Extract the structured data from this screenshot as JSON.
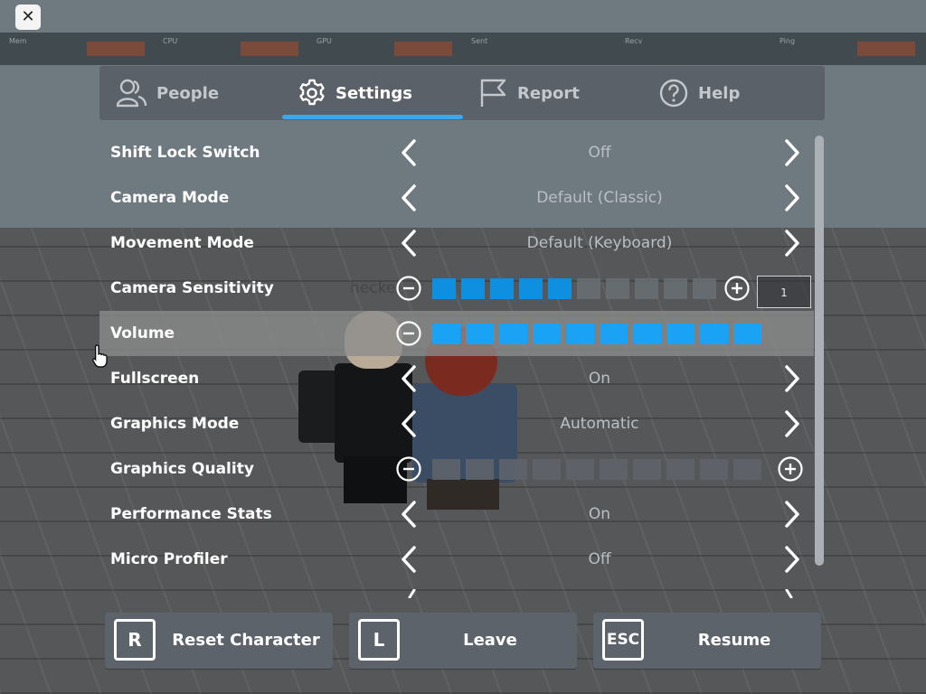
{
  "close_button": {
    "glyph": "✕"
  },
  "tabs": [
    {
      "label": "People",
      "icon": "people-icon",
      "active": false
    },
    {
      "label": "Settings",
      "icon": "gear-icon",
      "active": true
    },
    {
      "label": "Report",
      "icon": "flag-icon",
      "active": false
    },
    {
      "label": "Help",
      "icon": "help-icon",
      "active": false
    }
  ],
  "settings": {
    "shift_lock": {
      "label": "Shift Lock Switch",
      "value": "Off"
    },
    "camera_mode": {
      "label": "Camera Mode",
      "value": "Default (Classic)"
    },
    "movement_mode": {
      "label": "Movement Mode",
      "value": "Default (Keyboard)"
    },
    "camera_sensitivity": {
      "label": "Camera Sensitivity",
      "value": "1",
      "filled_segments": 5,
      "total_segments": 10
    },
    "volume": {
      "label": "Volume",
      "filled_segments": 10,
      "total_segments": 10
    },
    "fullscreen": {
      "label": "Fullscreen",
      "value": "On"
    },
    "graphics_mode": {
      "label": "Graphics Mode",
      "value": "Automatic"
    },
    "graphics_quality": {
      "label": "Graphics Quality",
      "filled_segments": 0,
      "total_segments": 10
    },
    "performance_stats": {
      "label": "Performance Stats",
      "value": "On"
    },
    "micro_profiler": {
      "label": "Micro Profiler",
      "value": "Off"
    }
  },
  "background_text": {
    "player_name_partial": "hecke"
  },
  "stats_bar": [
    "Mem",
    "CPU",
    "GPU",
    "Sent",
    "Recv",
    "Ping"
  ],
  "bottom_buttons": [
    {
      "key": "R",
      "label": "Reset Character"
    },
    {
      "key": "L",
      "label": "Leave"
    },
    {
      "key": "ESC",
      "label": "Resume"
    }
  ],
  "colors": {
    "accent": "#3aa8ea",
    "segment_on": "#1aa2f4",
    "panel": "#5c636b"
  }
}
